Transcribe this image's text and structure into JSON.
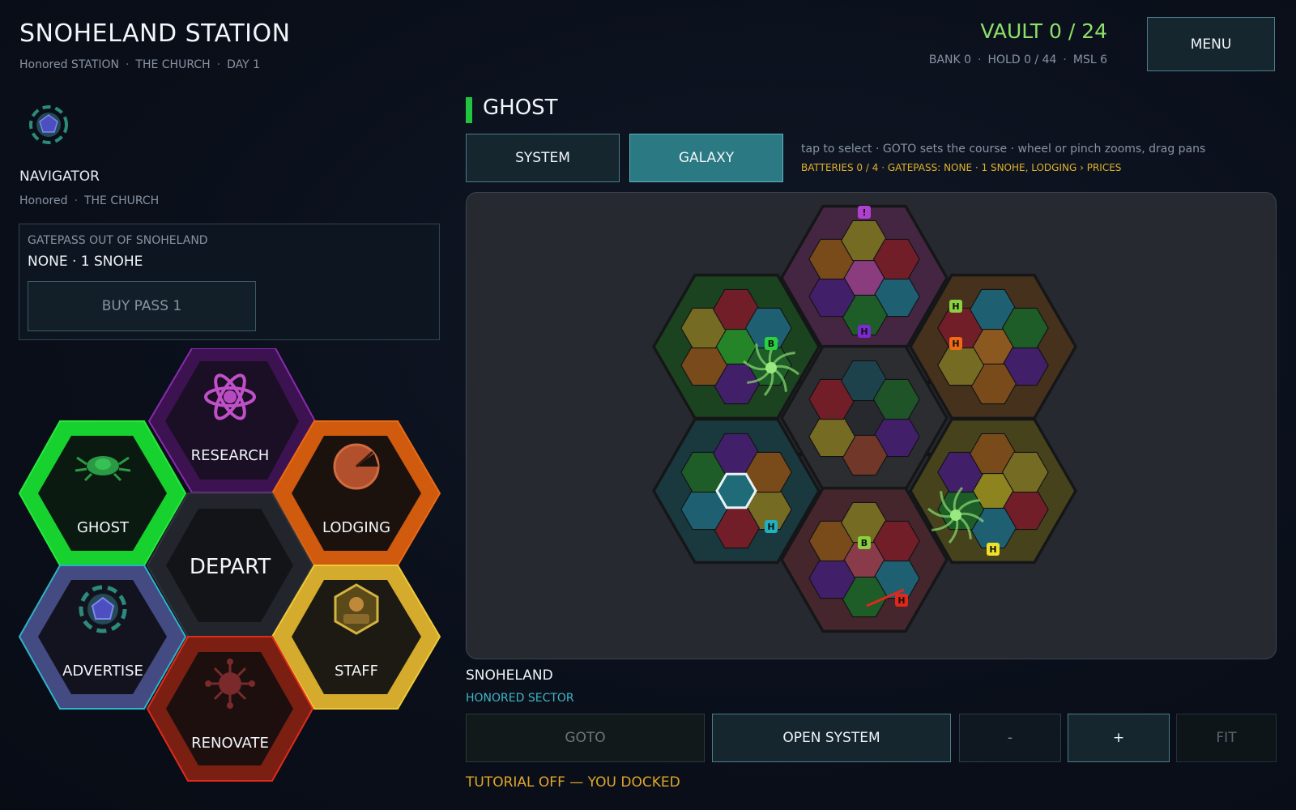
{
  "header": {
    "station_title": "SNOHELAND STATION",
    "sub_rank": "Honored STATION",
    "sub_faction": "THE CHURCH",
    "sub_day": "DAY 1",
    "vault": "VAULT 0 / 24",
    "bank": "BANK 0",
    "hold": "HOLD 0 / 44",
    "msl": "MSL 6",
    "menu_label": "MENU"
  },
  "navigator": {
    "label": "NAVIGATOR",
    "rank": "Honored",
    "faction": "THE CHURCH",
    "icon": "navigator-badge-icon"
  },
  "gatepass": {
    "label": "GATEPASS OUT OF SNOHELAND",
    "value": "NONE  ·  1 SNOHE",
    "buy_label": "BUY PASS  1"
  },
  "hex_menu": {
    "research": "RESEARCH",
    "ghost": "GHOST",
    "lodging": "LODGING",
    "depart": "DEPART",
    "advertise": "ADVERTISE",
    "staff": "STAFF",
    "renovate": "RENOVATE"
  },
  "panel": {
    "title": "GHOST",
    "tab_system": "SYSTEM",
    "tab_galaxy": "GALAXY",
    "active_tab": "GALAXY",
    "hint": "tap to select  ·  GOTO sets the course  ·  wheel or pinch zooms, drag pans",
    "status": "BATTERIES 0 / 4  ·  GATEPASS: NONE  ·  1 SNOHE, LODGING › PRICES"
  },
  "map": {
    "sector_colors": {
      "top": "#ee5fd8",
      "left": "#38e23a",
      "right": "#f0922a",
      "center": "#7a7e86",
      "bottom_left": "#2bb4c8",
      "bottom_right": "#f3e22b",
      "bottom": "#ec5e75"
    },
    "badges": [
      "!",
      "H",
      "B",
      "H",
      "H",
      "H",
      "B",
      "H",
      "H"
    ]
  },
  "selection": {
    "name": "SNOHELAND",
    "sector": "HONORED SECTOR"
  },
  "controls": {
    "goto": "GOTO",
    "open_system": "OPEN SYSTEM",
    "minus": "-",
    "plus": "+",
    "fit": "FIT"
  },
  "tutorial": "TUTORIAL OFF — YOU DOCKED"
}
